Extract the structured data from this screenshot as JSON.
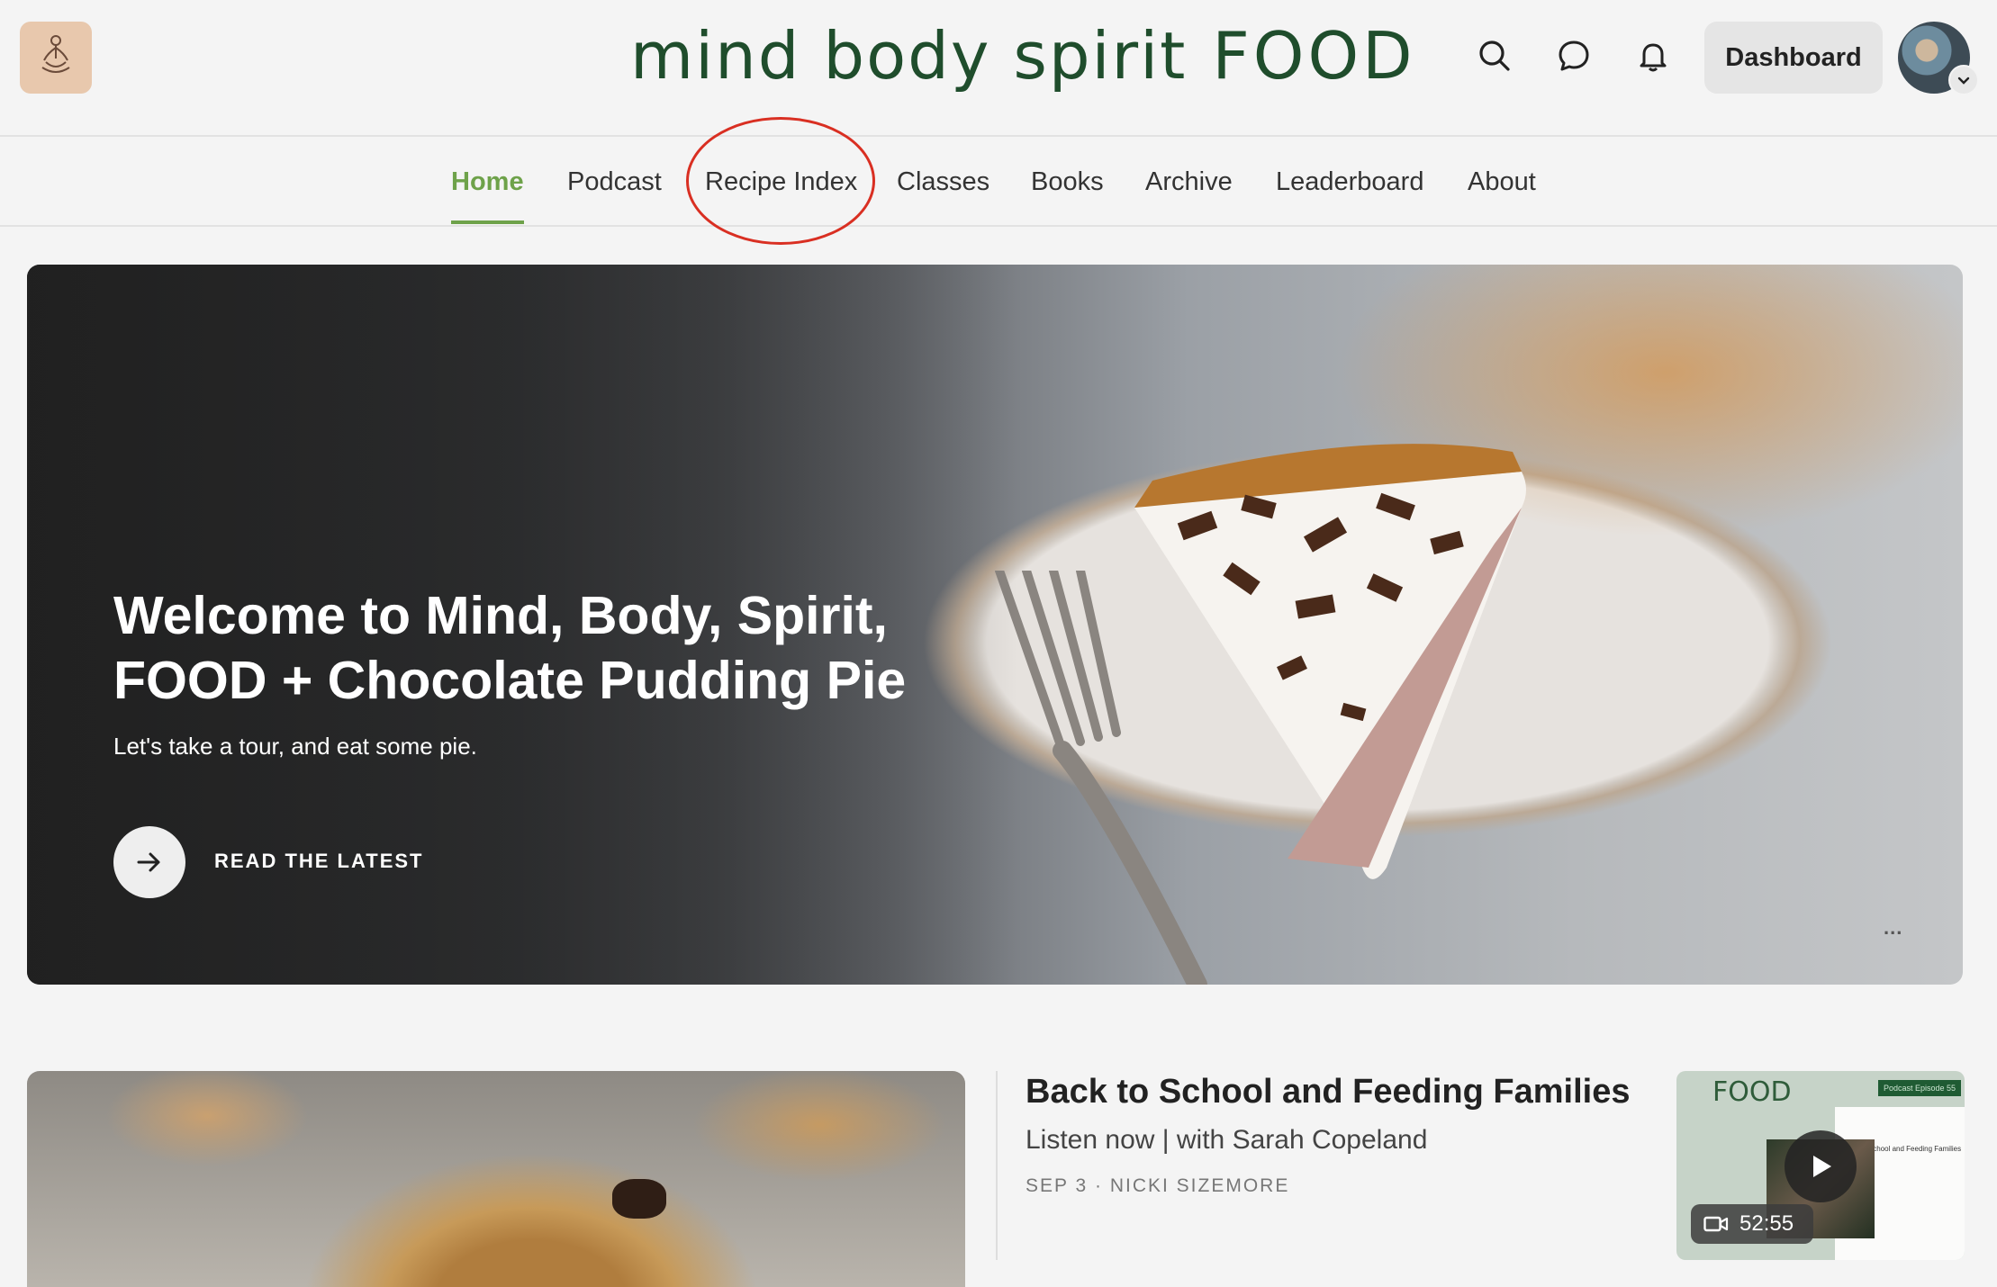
{
  "header": {
    "brand_left": "mind body spirit",
    "brand_right": "FOOD",
    "dashboard_label": "Dashboard",
    "icons": [
      "search-icon",
      "chat-icon",
      "bell-icon",
      "chevron-down-icon"
    ]
  },
  "nav": {
    "items": [
      {
        "label": "Home",
        "active": true
      },
      {
        "label": "Podcast"
      },
      {
        "label": "Recipe Index"
      },
      {
        "label": "Classes"
      },
      {
        "label": "Books"
      },
      {
        "label": "Archive"
      },
      {
        "label": "Leaderboard"
      },
      {
        "label": "About"
      }
    ],
    "accent": "#6ea24a"
  },
  "hero": {
    "title": "Welcome to Mind, Body, Spirit, FOOD + Chocolate Pudding Pie",
    "subtitle": "Let's take a tour, and eat some pie.",
    "cta": "READ THE LATEST",
    "more": "..."
  },
  "feed": {
    "post": {
      "title": "Back to School and Feeding Families",
      "subtitle": "Listen now | with Sarah Copeland",
      "meta": "SEP 3 · NICKI SIZEMORE",
      "thumbnail": {
        "brand": "FOOD",
        "tag": "Podcast Episode 55",
        "card_text": "Back to School and Feeding Families",
        "duration": "52:55"
      }
    }
  },
  "colors": {
    "brand_green": "#1f4d2c",
    "annotation_red": "#d92f22"
  }
}
